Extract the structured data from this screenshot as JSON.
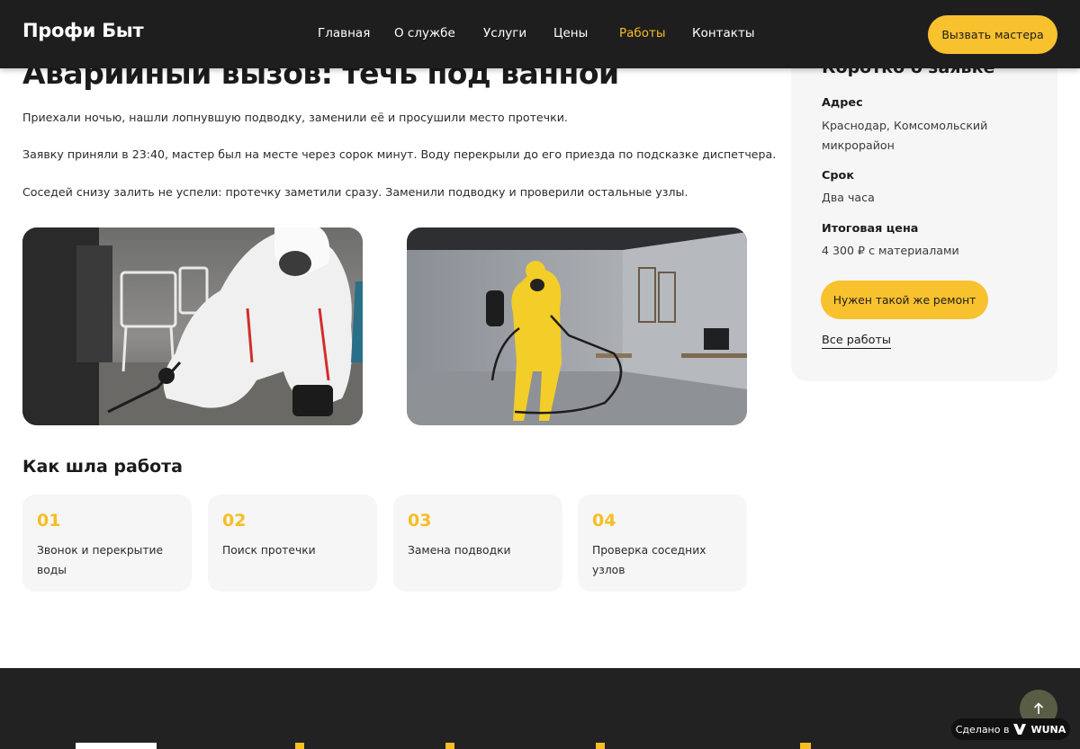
{
  "header": {
    "logo": "Профи Быт",
    "nav": [
      {
        "label": "Главная",
        "active": false
      },
      {
        "label": "О службе",
        "active": false
      },
      {
        "label": "Услуги",
        "active": false
      },
      {
        "label": "Цены",
        "active": false
      },
      {
        "label": "Работы",
        "active": true
      },
      {
        "label": "Контакты",
        "active": false
      }
    ],
    "cta_label": "Вызвать мастера"
  },
  "main": {
    "title": "Аварийный вызов: течь под ванной",
    "paragraphs": [
      "Приехали ночью, нашли лопнувшую подводку, заменили её и просушили место протечки.",
      "Заявку приняли в 23:40, мастер был на месте через сорок минут. Воду перекрыли до его приезда по подсказке диспетчера.",
      "Соседей снизу залить не успели: протечку заметили сразу. Заменили подводку и проверили остальные узлы."
    ],
    "section_title": "Как шла работа",
    "steps": [
      {
        "num": "01",
        "text": "Звонок и перекрытие воды"
      },
      {
        "num": "02",
        "text": "Поиск протечки"
      },
      {
        "num": "03",
        "text": "Замена подводки"
      },
      {
        "num": "04",
        "text": "Проверка соседних узлов"
      }
    ]
  },
  "sidebar": {
    "title": "Коротко о заявке",
    "address_label": "Адрес",
    "address_value": "Краснодар, Комсомольский микрорайон",
    "term_label": "Срок",
    "term_value": "Два часа",
    "price_label": "Итоговая цена",
    "price_value": "4 300 ₽ с материалами",
    "repair_button": "Нужен такой же ремонт",
    "all_works_link": "Все работы"
  },
  "footer": {
    "made_in": "Сделано в",
    "brand": "WUNA"
  },
  "colors": {
    "accent": "#f8c12e",
    "header_bg": "#1e1e1e",
    "card_bg": "#f6f6f6"
  }
}
